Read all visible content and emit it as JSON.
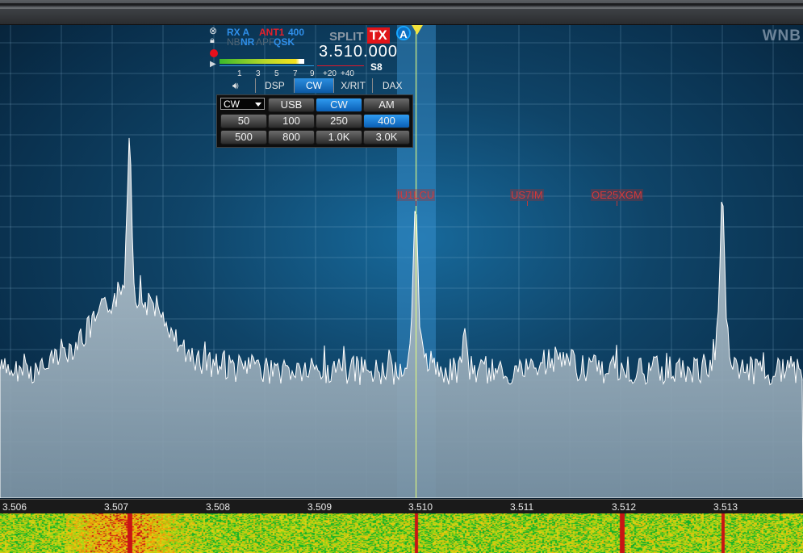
{
  "panadapter": {
    "wnb_label": "WNB",
    "spots": [
      {
        "call": "IU1LCU",
        "freq": 3.5102
      },
      {
        "call": "US7IM",
        "freq": 3.51095
      },
      {
        "call": "OE25XGM",
        "freq": 3.51178
      }
    ],
    "freq_scale": [
      "3.506",
      "3.507",
      "3.508",
      "3.509",
      "3.510",
      "3.511",
      "3.512",
      "3.513"
    ],
    "colors": {
      "passband": "#3c96d7",
      "carrier": "#e6ff7a",
      "spot": "#d4383a",
      "trace_fill": "#b7c6d1"
    }
  },
  "flag": {
    "rx": "RX A",
    "ant": "ANT1",
    "filter_width": "400",
    "nb": "NB",
    "nr": "NR",
    "apf": "APF",
    "qsk": "QSK",
    "split": "SPLIT",
    "tx": "TX",
    "slice_letter": "A",
    "frequency": "3.510.000",
    "s_meter_scale": [
      "1",
      "3",
      "5",
      "7",
      "9",
      "+20",
      "+40"
    ],
    "s_meter_reading": "S8",
    "s_meter_level": 0.55,
    "tabs": [
      {
        "label": "speaker-icon",
        "type": "icon",
        "active": false
      },
      {
        "label": "DSP",
        "active": false
      },
      {
        "label": "CW",
        "active": true
      },
      {
        "label": "X/RIT",
        "active": false
      },
      {
        "label": "DAX",
        "active": false
      }
    ],
    "mode_select": "CW",
    "mode_buttons": [
      {
        "label": "USB",
        "active": false
      },
      {
        "label": "CW",
        "active": true
      },
      {
        "label": "AM",
        "active": false
      }
    ],
    "filter_buttons": [
      {
        "label": "50",
        "active": false
      },
      {
        "label": "100",
        "active": false
      },
      {
        "label": "250",
        "active": false
      },
      {
        "label": "400",
        "active": true
      },
      {
        "label": "500",
        "active": false
      },
      {
        "label": "800",
        "active": false
      },
      {
        "label": "1.0K",
        "active": false
      },
      {
        "label": "3.0K",
        "active": false
      }
    ]
  }
}
